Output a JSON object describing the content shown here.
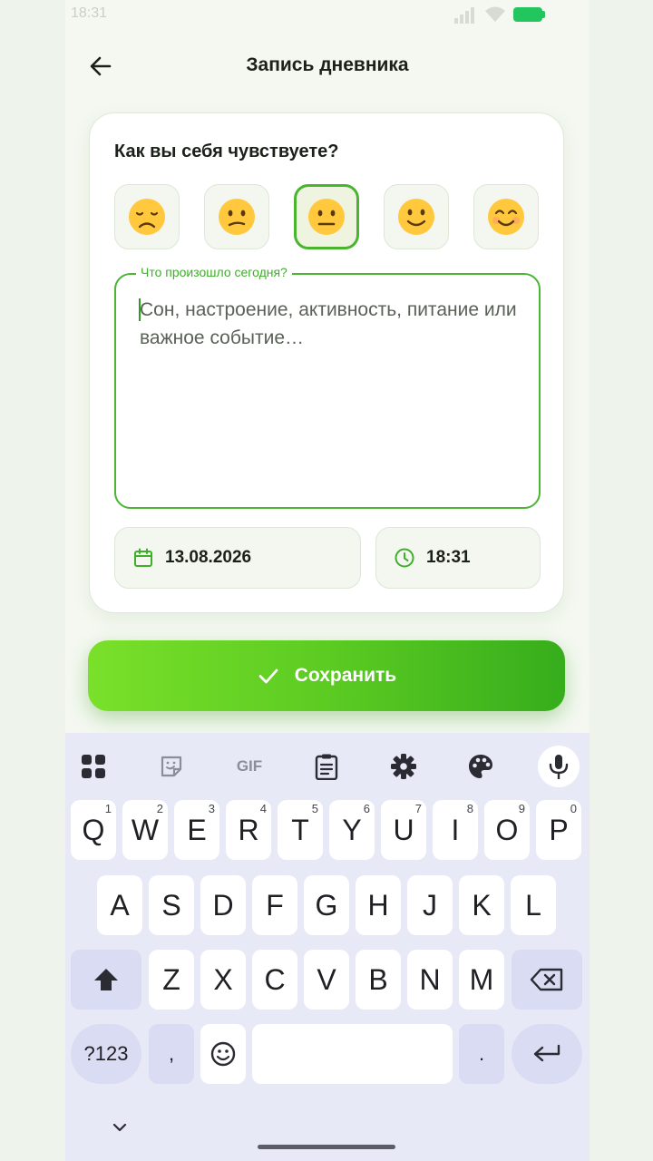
{
  "status_bar": {
    "time": "18:31"
  },
  "header": {
    "title": "Запись дневника",
    "back_icon": "arrow-left-icon"
  },
  "card": {
    "question": "Как вы себя чувствуете?",
    "moods": [
      {
        "icon": "sad-face-icon",
        "selected": false
      },
      {
        "icon": "confused-face-icon",
        "selected": false
      },
      {
        "icon": "neutral-face-icon",
        "selected": true
      },
      {
        "icon": "slightly-smiling-face-icon",
        "selected": false
      },
      {
        "icon": "smiling-face-icon",
        "selected": false
      }
    ],
    "note": {
      "label": "Что произошло сегодня?",
      "placeholder": "Сон, настроение, активность, питание или важное событие…",
      "value": ""
    },
    "date": {
      "icon": "calendar-icon",
      "value": "13.08.2026"
    },
    "time": {
      "icon": "clock-icon",
      "value": "18:31"
    }
  },
  "save_button": {
    "label": "Сохранить",
    "icon": "check-icon"
  },
  "colors": {
    "accent": "#4cb534",
    "button_start": "#7ae02a",
    "button_end": "#36ad1c",
    "text": "#1a2118",
    "keyboard_bg": "#e8e9f7"
  },
  "keyboard": {
    "toolbar": [
      {
        "icon": "apps-grid-icon"
      },
      {
        "icon": "sticker-icon"
      },
      {
        "label": "GIF"
      },
      {
        "icon": "clipboard-icon"
      },
      {
        "icon": "settings-gear-icon"
      },
      {
        "icon": "palette-icon"
      },
      {
        "icon": "microphone-icon"
      }
    ],
    "row1": [
      {
        "k": "Q",
        "n": "1"
      },
      {
        "k": "W",
        "n": "2"
      },
      {
        "k": "E",
        "n": "3"
      },
      {
        "k": "R",
        "n": "4"
      },
      {
        "k": "T",
        "n": "5"
      },
      {
        "k": "Y",
        "n": "6"
      },
      {
        "k": "U",
        "n": "7"
      },
      {
        "k": "I",
        "n": "8"
      },
      {
        "k": "O",
        "n": "9"
      },
      {
        "k": "P",
        "n": "0"
      }
    ],
    "row2": [
      "A",
      "S",
      "D",
      "F",
      "G",
      "H",
      "J",
      "K",
      "L"
    ],
    "row3": [
      "Z",
      "X",
      "C",
      "V",
      "B",
      "N",
      "M"
    ],
    "row4": {
      "symbols": "?123",
      "comma": ",",
      "period": "."
    }
  }
}
